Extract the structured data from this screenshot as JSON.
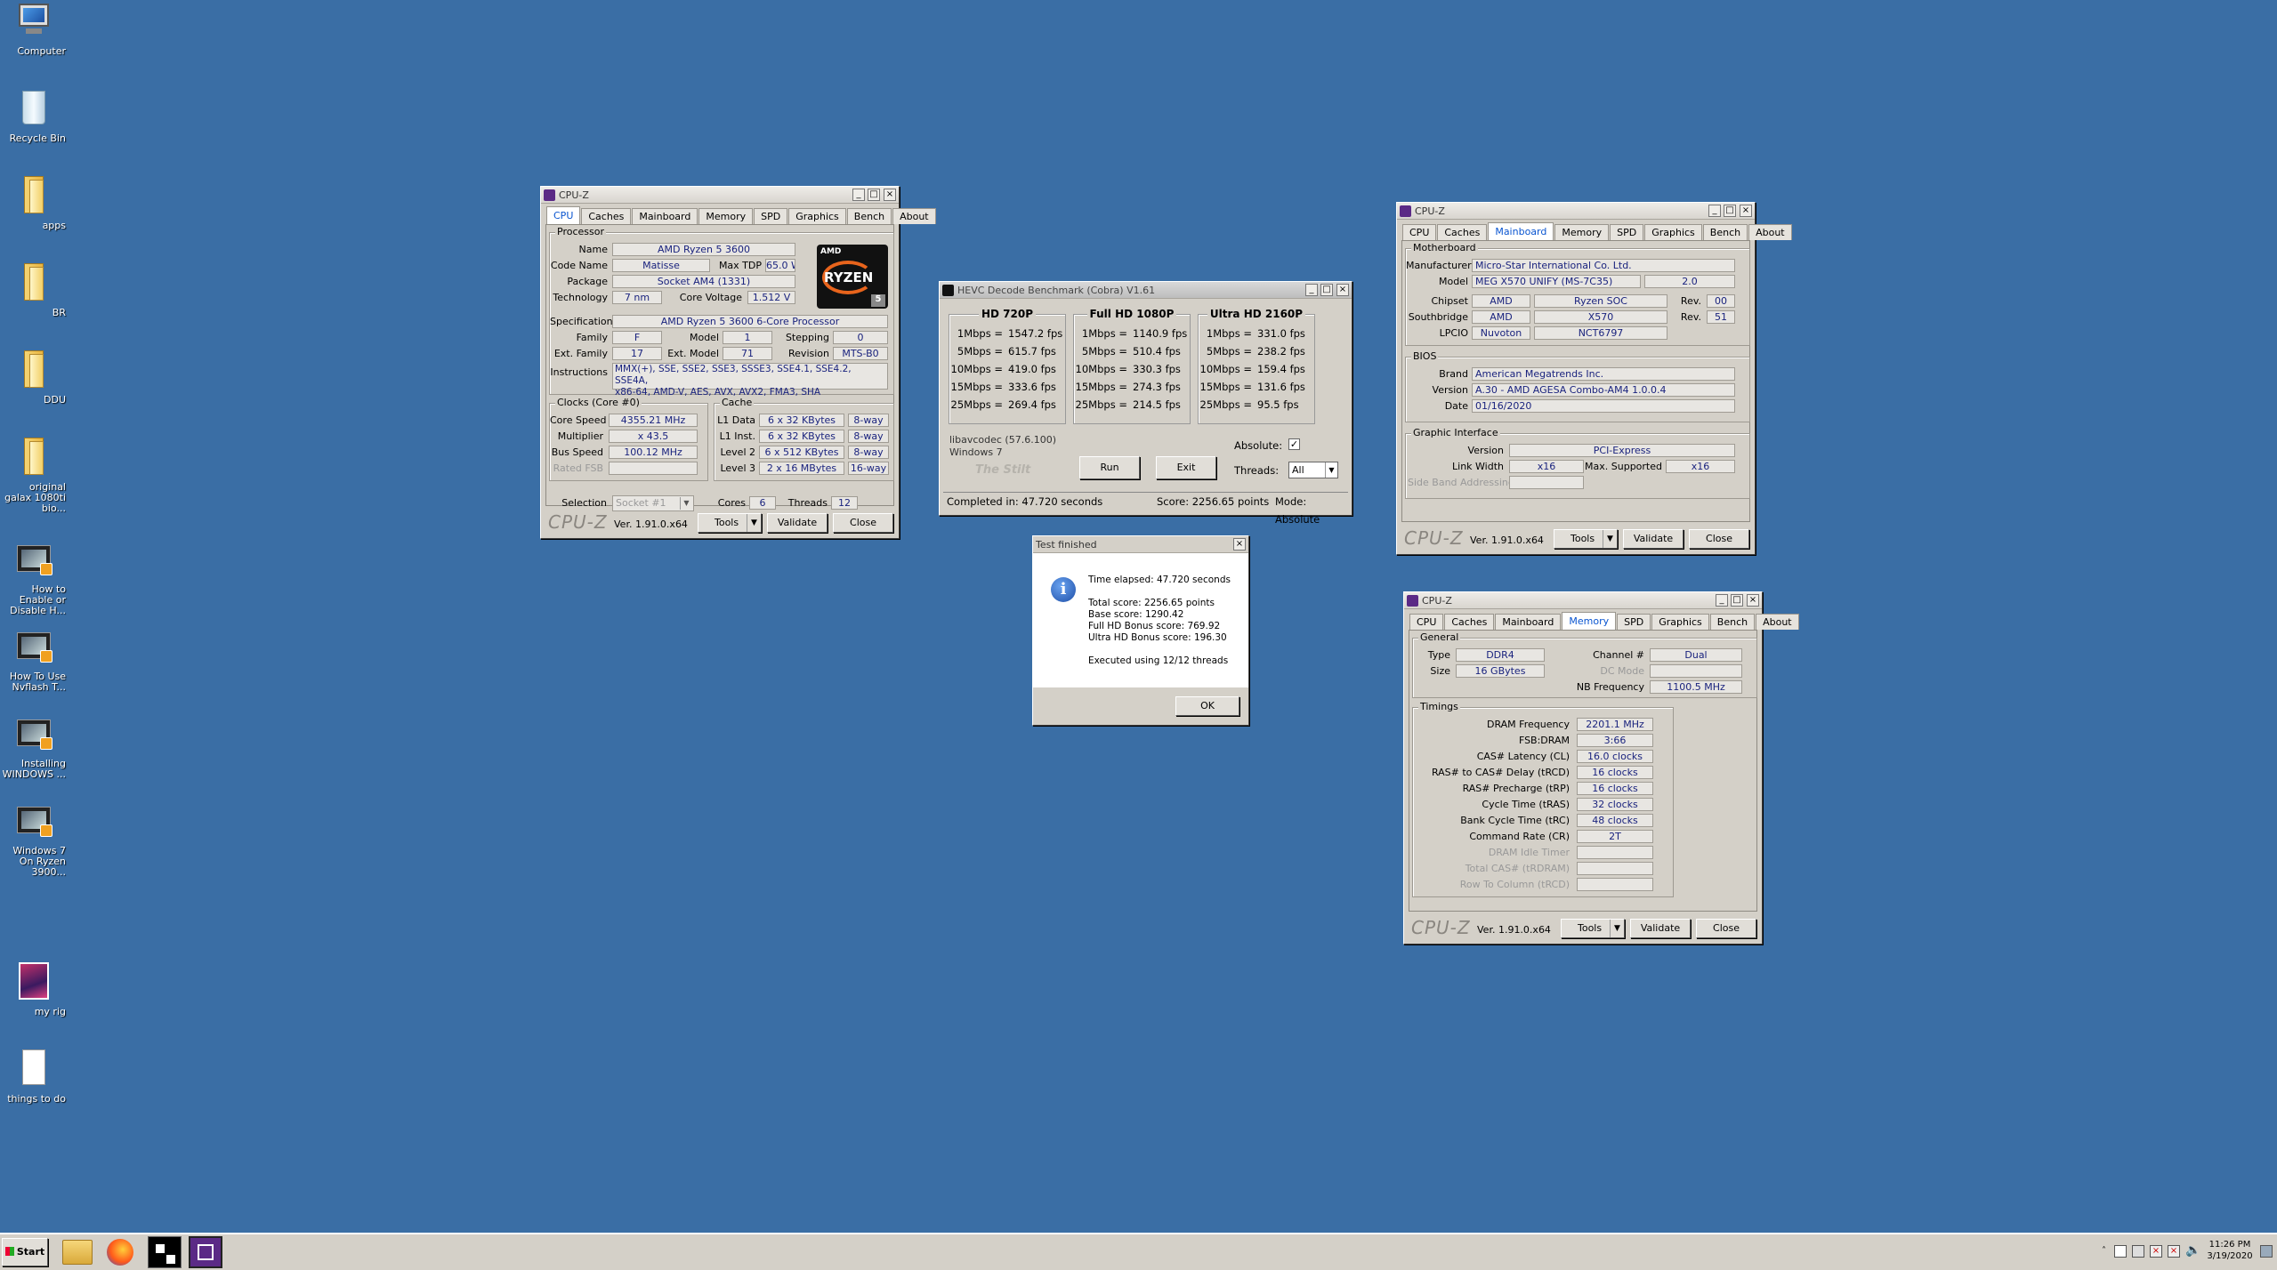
{
  "desktop": {
    "icons": [
      {
        "label": "Computer",
        "icon": "computer-icon"
      },
      {
        "label": "Recycle Bin",
        "icon": "recycle-bin-icon"
      },
      {
        "label": "apps",
        "icon": "folder-icon"
      },
      {
        "label": "BR",
        "icon": "folder-icon"
      },
      {
        "label": "DDU",
        "icon": "folder-icon"
      },
      {
        "label": "original galax 1080ti bio...",
        "icon": "folder-icon"
      },
      {
        "label": "How to Enable or Disable H...",
        "icon": "video-icon"
      },
      {
        "label": "How To Use Nvflash T...",
        "icon": "video-icon"
      },
      {
        "label": "Installing WINDOWS ...",
        "icon": "video-icon"
      },
      {
        "label": "Windows 7 On Ryzen 3900...",
        "icon": "video-icon"
      },
      {
        "label": "my rig",
        "icon": "image-icon"
      },
      {
        "label": "things to do",
        "icon": "document-icon"
      }
    ]
  },
  "cpuz_cpu": {
    "title": "CPU-Z",
    "tabs": [
      "CPU",
      "Caches",
      "Mainboard",
      "Memory",
      "SPD",
      "Graphics",
      "Bench",
      "About"
    ],
    "active_tab": "CPU",
    "processor_group": "Processor",
    "name_label": "Name",
    "name": "AMD Ryzen 5 3600",
    "codename_label": "Code Name",
    "codename": "Matisse",
    "maxtdp_label": "Max TDP",
    "maxtdp": "65.0 W",
    "package_label": "Package",
    "package": "Socket AM4 (1331)",
    "tech_label": "Technology",
    "tech": "7 nm",
    "voltage_label": "Core Voltage",
    "voltage": "1.512 V",
    "spec_label": "Specification",
    "spec": "AMD Ryzen 5 3600 6-Core Processor",
    "family_label": "Family",
    "family": "F",
    "model_label": "Model",
    "model": "1",
    "stepping_label": "Stepping",
    "stepping": "0",
    "extfamily_label": "Ext. Family",
    "extfamily": "17",
    "extmodel_label": "Ext. Model",
    "extmodel": "71",
    "revision_label": "Revision",
    "revision": "MTS-B0",
    "instr_label": "Instructions",
    "instr1": "MMX(+), SSE, SSE2, SSE3, SSSE3, SSE4.1, SSE4.2, SSE4A,",
    "instr2": "x86-64, AMD-V, AES, AVX, AVX2, FMA3, SHA",
    "logo_brand": "AMD",
    "logo_text": "RYZEN",
    "logo_num": "5",
    "clocks_group": "Clocks (Core #0)",
    "corespeed_label": "Core Speed",
    "corespeed": "4355.21 MHz",
    "multiplier_label": "Multiplier",
    "multiplier": "x 43.5",
    "busspeed_label": "Bus Speed",
    "busspeed": "100.12 MHz",
    "ratedfsb_label": "Rated FSB",
    "cache_group": "Cache",
    "l1d_label": "L1 Data",
    "l1d": "6 x 32 KBytes",
    "l1d_way": "8-way",
    "l1i_label": "L1 Inst.",
    "l1i": "6 x 32 KBytes",
    "l1i_way": "8-way",
    "l2_label": "Level 2",
    "l2": "6 x 512 KBytes",
    "l2_way": "8-way",
    "l3_label": "Level 3",
    "l3": "2 x 16 MBytes",
    "l3_way": "16-way",
    "selection_label": "Selection",
    "selection": "Socket #1",
    "cores_label": "Cores",
    "cores": "6",
    "threads_label": "Threads",
    "threads": "12",
    "logo": "CPU-Z",
    "version": "Ver. 1.91.0.x64",
    "tools": "Tools",
    "validate": "Validate",
    "close": "Close"
  },
  "hevc": {
    "title": "HEVC Decode Benchmark (Cobra) V1.61",
    "cols": [
      {
        "title": "HD 720P",
        "rows": [
          [
            "1Mbps =",
            "1547.2 fps"
          ],
          [
            "5Mbps =",
            "615.7 fps"
          ],
          [
            "10Mbps =",
            "419.0 fps"
          ],
          [
            "15Mbps =",
            "333.6 fps"
          ],
          [
            "25Mbps =",
            "269.4 fps"
          ]
        ]
      },
      {
        "title": "Full HD 1080P",
        "rows": [
          [
            "1Mbps =",
            "1140.9 fps"
          ],
          [
            "5Mbps =",
            "510.4 fps"
          ],
          [
            "10Mbps =",
            "330.3 fps"
          ],
          [
            "15Mbps =",
            "274.3 fps"
          ],
          [
            "25Mbps =",
            "214.5 fps"
          ]
        ]
      },
      {
        "title": "Ultra HD 2160P",
        "rows": [
          [
            "1Mbps =",
            "331.0 fps"
          ],
          [
            "5Mbps =",
            "238.2 fps"
          ],
          [
            "10Mbps =",
            "159.4 fps"
          ],
          [
            "15Mbps =",
            "131.6 fps"
          ],
          [
            "25Mbps =",
            "95.5 fps"
          ]
        ]
      }
    ],
    "codec": "libavcodec (57.6.100)",
    "os": "Windows 7",
    "brand": "The Stilt",
    "run": "Run",
    "exit": "Exit",
    "absolute_label": "Absolute:",
    "threads_label": "Threads:",
    "threads": "All",
    "status_completed": "Completed in: 47.720 seconds",
    "status_score": "Score: 2256.65 points",
    "status_mode": "Mode: Absolute"
  },
  "dialog": {
    "title": "Test finished",
    "lines": [
      "Time elapsed:  47.720 seconds",
      "",
      "Total score:  2256.65 points",
      "Base score: 1290.42",
      "Full HD Bonus score: 769.92",
      "Ultra HD Bonus score: 196.30",
      "",
      "Executed using 12/12 threads"
    ],
    "ok": "OK"
  },
  "cpuz_mb": {
    "title": "CPU-Z",
    "tabs": [
      "CPU",
      "Caches",
      "Mainboard",
      "Memory",
      "SPD",
      "Graphics",
      "Bench",
      "About"
    ],
    "active_tab": "Mainboard",
    "mb_group": "Motherboard",
    "manufacturer_label": "Manufacturer",
    "manufacturer": "Micro-Star International Co. Ltd.",
    "model_label": "Model",
    "model": "MEG X570 UNIFY (MS-7C35)",
    "model_rev": "2.0",
    "chipset_label": "Chipset",
    "chipset_vendor": "AMD",
    "chipset": "Ryzen SOC",
    "chipset_rev_label": "Rev.",
    "chipset_rev": "00",
    "southbridge_label": "Southbridge",
    "sb_vendor": "AMD",
    "sb": "X570",
    "sb_rev_label": "Rev.",
    "sb_rev": "51",
    "lpcio_label": "LPCIO",
    "lpcio_vendor": "Nuvoton",
    "lpcio": "NCT6797",
    "bios_group": "BIOS",
    "brand_label": "Brand",
    "brand": "American Megatrends Inc.",
    "version_label": "Version",
    "bios_version": "A.30 - AMD AGESA Combo-AM4 1.0.0.4",
    "date_label": "Date",
    "date": "01/16/2020",
    "gi_group": "Graphic Interface",
    "gi_version_label": "Version",
    "gi_version": "PCI-Express",
    "linkwidth_label": "Link Width",
    "linkwidth": "x16",
    "maxsup_label": "Max. Supported",
    "maxsup": "x16",
    "sideband_label": "Side Band Addressing",
    "logo": "CPU-Z",
    "version": "Ver. 1.91.0.x64",
    "tools": "Tools",
    "validate": "Validate",
    "close": "Close"
  },
  "cpuz_mem": {
    "title": "CPU-Z",
    "tabs": [
      "CPU",
      "Caches",
      "Mainboard",
      "Memory",
      "SPD",
      "Graphics",
      "Bench",
      "About"
    ],
    "active_tab": "Memory",
    "general_group": "General",
    "type_label": "Type",
    "type": "DDR4",
    "size_label": "Size",
    "size": "16 GBytes",
    "channel_label": "Channel #",
    "channel": "Dual",
    "dcmode_label": "DC Mode",
    "nbfreq_label": "NB Frequency",
    "nbfreq": "1100.5 MHz",
    "timings_group": "Timings",
    "timings": [
      {
        "label": "DRAM Frequency",
        "value": "2201.1 MHz",
        "dis": false
      },
      {
        "label": "FSB:DRAM",
        "value": "3:66",
        "dis": false
      },
      {
        "label": "CAS# Latency (CL)",
        "value": "16.0 clocks",
        "dis": false
      },
      {
        "label": "RAS# to CAS# Delay (tRCD)",
        "value": "16 clocks",
        "dis": false
      },
      {
        "label": "RAS# Precharge (tRP)",
        "value": "16 clocks",
        "dis": false
      },
      {
        "label": "Cycle Time (tRAS)",
        "value": "32 clocks",
        "dis": false
      },
      {
        "label": "Bank Cycle Time (tRC)",
        "value": "48 clocks",
        "dis": false
      },
      {
        "label": "Command Rate (CR)",
        "value": "2T",
        "dis": false
      },
      {
        "label": "DRAM Idle Timer",
        "value": "",
        "dis": true
      },
      {
        "label": "Total CAS# (tRDRAM)",
        "value": "",
        "dis": true
      },
      {
        "label": "Row To Column (tRCD)",
        "value": "",
        "dis": true
      }
    ],
    "logo": "CPU-Z",
    "version": "Ver. 1.91.0.x64",
    "tools": "Tools",
    "validate": "Validate",
    "close": "Close"
  },
  "taskbar": {
    "start": "Start",
    "time": "11:26 PM",
    "date": "3/19/2020"
  }
}
